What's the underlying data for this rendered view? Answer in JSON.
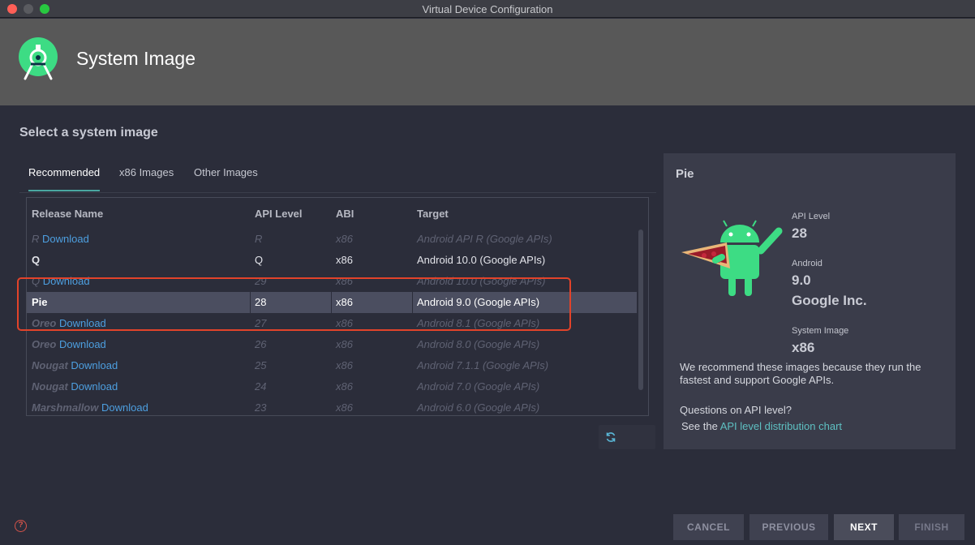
{
  "window": {
    "title": "Virtual Device Configuration"
  },
  "header": {
    "title": "System Image"
  },
  "subtitle": "Select a system image",
  "tabs": [
    {
      "label": "Recommended",
      "active": true
    },
    {
      "label": "x86 Images",
      "active": false
    },
    {
      "label": "Other Images",
      "active": false
    }
  ],
  "table": {
    "columns": [
      "Release Name",
      "API Level",
      "ABI",
      "Target"
    ],
    "rows": [
      {
        "name": "R",
        "download": "Download",
        "api": "R",
        "abi": "x86",
        "target": "Android API R (Google APIs)"
      },
      {
        "name": "Q",
        "download": "",
        "api": "Q",
        "abi": "x86",
        "target": "Android 10.0 (Google APIs)"
      },
      {
        "name": "Q",
        "download": "Download",
        "api": "29",
        "abi": "x86",
        "target": "Android 10.0 (Google APIs)"
      },
      {
        "name": "Pie",
        "download": "",
        "api": "28",
        "abi": "x86",
        "target": "Android 9.0 (Google APIs)"
      },
      {
        "name": "Oreo",
        "download": "Download",
        "api": "27",
        "abi": "x86",
        "target": "Android 8.1 (Google APIs)"
      },
      {
        "name": "Oreo",
        "download": "Download",
        "api": "26",
        "abi": "x86",
        "target": "Android 8.0 (Google APIs)"
      },
      {
        "name": "Nougat",
        "download": "Download",
        "api": "25",
        "abi": "x86",
        "target": "Android 7.1.1 (Google APIs)"
      },
      {
        "name": "Nougat",
        "download": "Download",
        "api": "24",
        "abi": "x86",
        "target": "Android 7.0 (Google APIs)"
      },
      {
        "name": "Marshmallow",
        "download": "Download",
        "api": "23",
        "abi": "x86",
        "target": "Android 6.0 (Google APIs)"
      }
    ],
    "selected_index": 3
  },
  "details": {
    "title": "Pie",
    "api_level_label": "API Level",
    "api_level": "28",
    "android_label": "Android",
    "android_version": "9.0",
    "vendor": "Google Inc.",
    "system_image_label": "System Image",
    "system_image": "x86",
    "description": "We recommend these images because they run the fastest and support Google APIs.",
    "question": "Questions on API level?",
    "see_prefix": "See the ",
    "link_text": "API level distribution chart"
  },
  "icons": {
    "logo": "android-studio-logo-icon",
    "refresh": "refresh-icon",
    "help": "help-icon",
    "mascot": "android-pie-mascot-icon"
  },
  "buttons": {
    "cancel": "CANCEL",
    "previous": "PREVIOUS",
    "next": "NEXT",
    "finish": "FINISH"
  },
  "help_glyph": "?",
  "colors": {
    "accent": "#4aa7a1",
    "link": "#4d9fe0",
    "highlight": "#e2432a",
    "android_green": "#3ddc84"
  }
}
